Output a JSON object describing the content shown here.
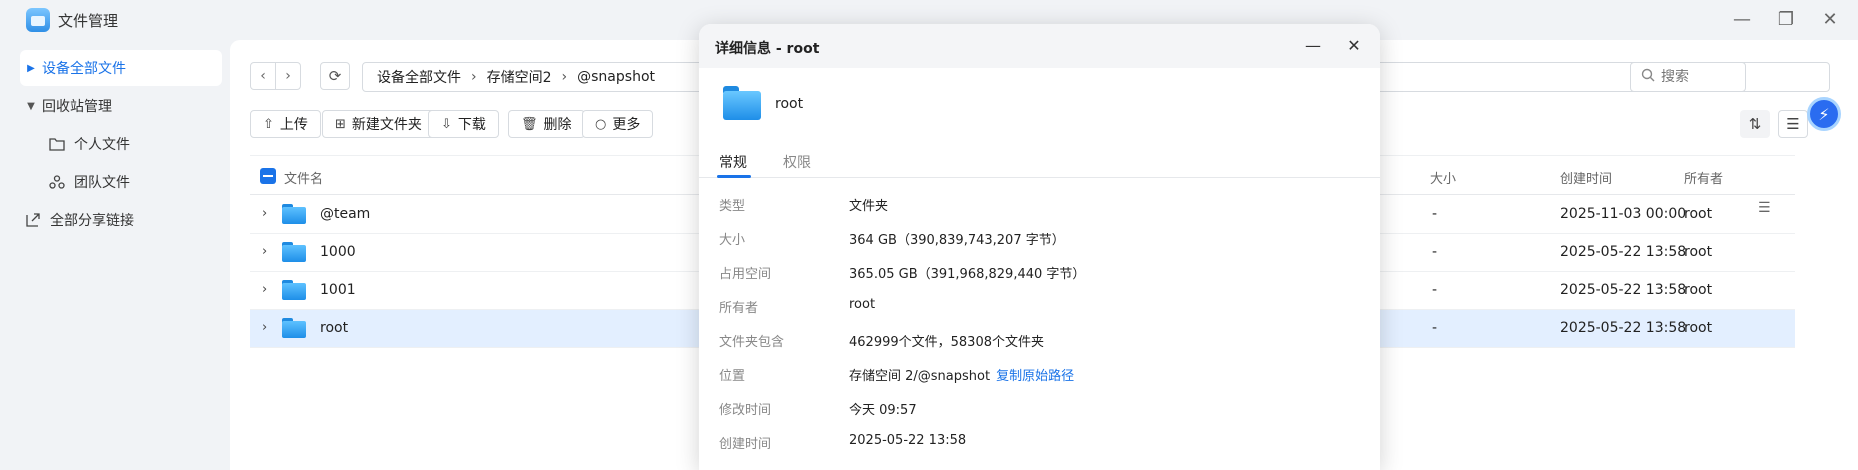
{
  "app": {
    "title": "文件管理"
  },
  "sidebar": {
    "items": [
      {
        "label": "设备全部文件"
      },
      {
        "label": "回收站管理"
      },
      {
        "label": "个人文件"
      },
      {
        "label": "团队文件"
      },
      {
        "label": "全部分享链接"
      }
    ]
  },
  "breadcrumb": [
    "设备全部文件",
    "存储空间2",
    "@snapshot"
  ],
  "search": {
    "placeholder": "搜索"
  },
  "toolbar": {
    "upload": "上传",
    "new_folder": "新建文件夹",
    "download": "下载",
    "delete": "删除",
    "more": "更多"
  },
  "table": {
    "headers": {
      "name": "文件名",
      "size": "大小",
      "created": "创建时间",
      "owner": "所有者"
    },
    "rows": [
      {
        "name": "@team",
        "size": "-",
        "created": "2025-11-03 00:00",
        "owner": "root"
      },
      {
        "name": "1000",
        "size": "-",
        "created": "2025-05-22 13:58",
        "owner": "root"
      },
      {
        "name": "1001",
        "size": "-",
        "created": "2025-05-22 13:58",
        "owner": "root"
      },
      {
        "name": "root",
        "size": "-",
        "created": "2025-05-22 13:58",
        "owner": "root"
      }
    ]
  },
  "dialog": {
    "title": "详细信息 - root",
    "folder_name": "root",
    "tabs": [
      "常规",
      "权限"
    ],
    "props": [
      {
        "label": "类型",
        "value": "文件夹"
      },
      {
        "label": "大小",
        "value": "364 GB（390,839,743,207 字节）"
      },
      {
        "label": "占用空间",
        "value": "365.05 GB（391,968,829,440 字节）"
      },
      {
        "label": "所有者",
        "value": "root"
      },
      {
        "label": "文件夹包含",
        "value": "462999个文件，58308个文件夹"
      },
      {
        "label": "位置",
        "value": "存储空间 2/@snapshot",
        "link": "复制原始路径"
      },
      {
        "label": "修改时间",
        "value": "今天 09:57"
      },
      {
        "label": "创建时间",
        "value": "2025-05-22 13:58"
      }
    ]
  },
  "colors": {
    "accent": "#1a73e8",
    "selected_row": "#e3efff",
    "sidebar_bg": "#f1f3f6"
  }
}
